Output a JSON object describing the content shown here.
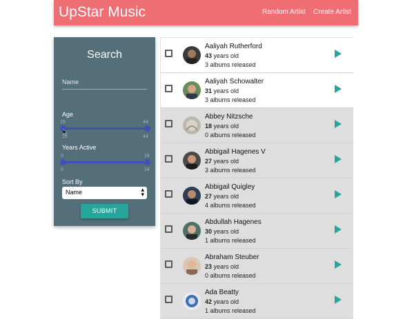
{
  "navbar": {
    "brand": "UpStar Music",
    "links": [
      "Random Artist",
      "Create Artist"
    ]
  },
  "search": {
    "title": "Search",
    "name_placeholder": "Name",
    "age": {
      "label": "Age",
      "min": 15,
      "max": 44,
      "low_value": 15,
      "high_value": 44
    },
    "years_active": {
      "label": "Years Active",
      "min": 0,
      "max": 14,
      "low_value": 0,
      "high_value": 14
    },
    "sort_by": {
      "label": "Sort By",
      "selected": "Name"
    },
    "submit_label": "SUBMIT"
  },
  "colors": {
    "navbar": "#ee6e73",
    "panel": "#546e7a",
    "accent": "#26a69a",
    "slider": "#3f51b5"
  },
  "artists": [
    {
      "name": "Aaliyah Rutherford",
      "age": "43",
      "age_suffix": " years old",
      "albums": "3 albums released"
    },
    {
      "name": "Aaliyah Schowalter",
      "age": "31",
      "age_suffix": " years old",
      "albums": "3 albums released"
    },
    {
      "name": "Abbey Nitzsche",
      "age": "18",
      "age_suffix": " years old",
      "albums": "0 albums released"
    },
    {
      "name": "Abbigail Hagenes V",
      "age": "27",
      "age_suffix": " years old",
      "albums": "3 albums released"
    },
    {
      "name": "Abbigail Quigley",
      "age": "27",
      "age_suffix": " years old",
      "albums": "4 albums released"
    },
    {
      "name": "Abdullah Hagenes",
      "age": "30",
      "age_suffix": " years old",
      "albums": "1 albums released"
    },
    {
      "name": "Abraham Steuber",
      "age": "23",
      "age_suffix": " years old",
      "albums": "0 albums released"
    },
    {
      "name": "Ada Beatty",
      "age": "42",
      "age_suffix": " years old",
      "albums": "1 albums released"
    }
  ]
}
